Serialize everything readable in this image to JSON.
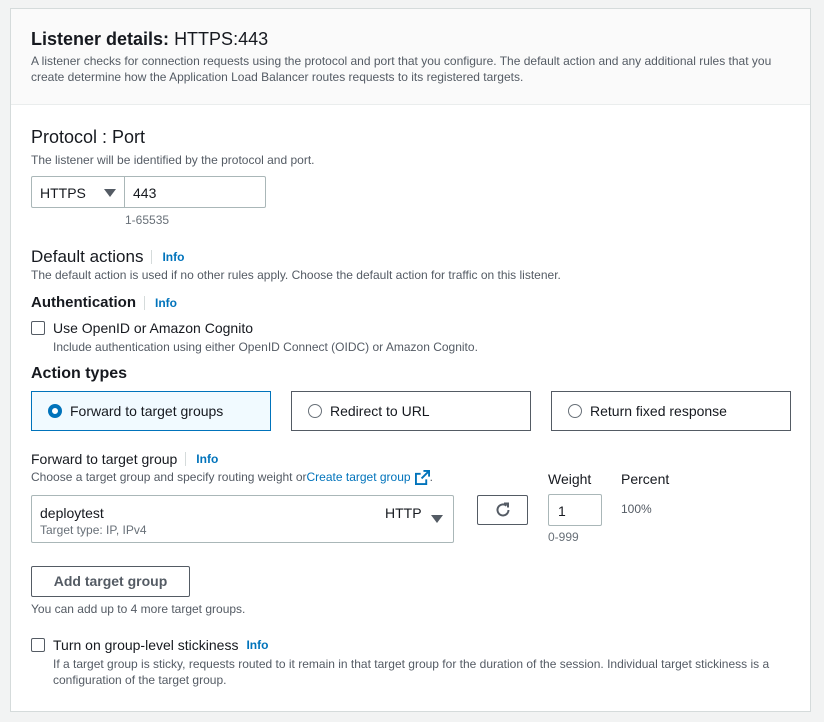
{
  "header": {
    "title_prefix": "Listener details:",
    "title_value": "HTTPS:443",
    "description": "A listener checks for connection requests using the protocol and port that you configure. The default action and any additional rules that you create determine how the Application Load Balancer routes requests to its registered targets."
  },
  "protocol_port": {
    "title": "Protocol : Port",
    "description": "The listener will be identified by the protocol and port.",
    "protocol_value": "HTTPS",
    "port_value": "443",
    "port_hint": "1-65535"
  },
  "default_actions": {
    "title": "Default actions",
    "info": "Info",
    "description": "The default action is used if no other rules apply. Choose the default action for traffic on this listener."
  },
  "authentication": {
    "title": "Authentication",
    "info": "Info",
    "checkbox_label": "Use OpenID or Amazon Cognito",
    "checkbox_description": "Include authentication using either OpenID Connect (OIDC) or Amazon Cognito."
  },
  "action_types": {
    "title": "Action types",
    "options": [
      {
        "label": "Forward to target groups",
        "selected": true
      },
      {
        "label": "Redirect to URL",
        "selected": false
      },
      {
        "label": "Return fixed response",
        "selected": false
      }
    ]
  },
  "forward": {
    "title": "Forward to target group",
    "info": "Info",
    "description_prefix": "Choose a target group and specify routing weight or ",
    "create_link": "Create target group",
    "target_group_name": "deploytest",
    "target_group_protocol": "HTTP",
    "target_type": "Target type: IP, IPv4",
    "weight_label": "Weight",
    "percent_label": "Percent",
    "weight_value": "1",
    "weight_hint": "0-999",
    "percent_value": "100%"
  },
  "add_target_group": {
    "button_label": "Add target group",
    "hint": "You can add up to 4 more target groups."
  },
  "stickiness": {
    "checkbox_label": "Turn on group-level stickiness",
    "info": "Info",
    "description": "If a target group is sticky, requests routed to it remain in that target group for the duration of the session. Individual target stickiness is a configuration of the target group."
  },
  "colors": {
    "accent": "#0073bb",
    "border": "#aab7b8",
    "text": "#16191f",
    "muted": "#687078"
  }
}
